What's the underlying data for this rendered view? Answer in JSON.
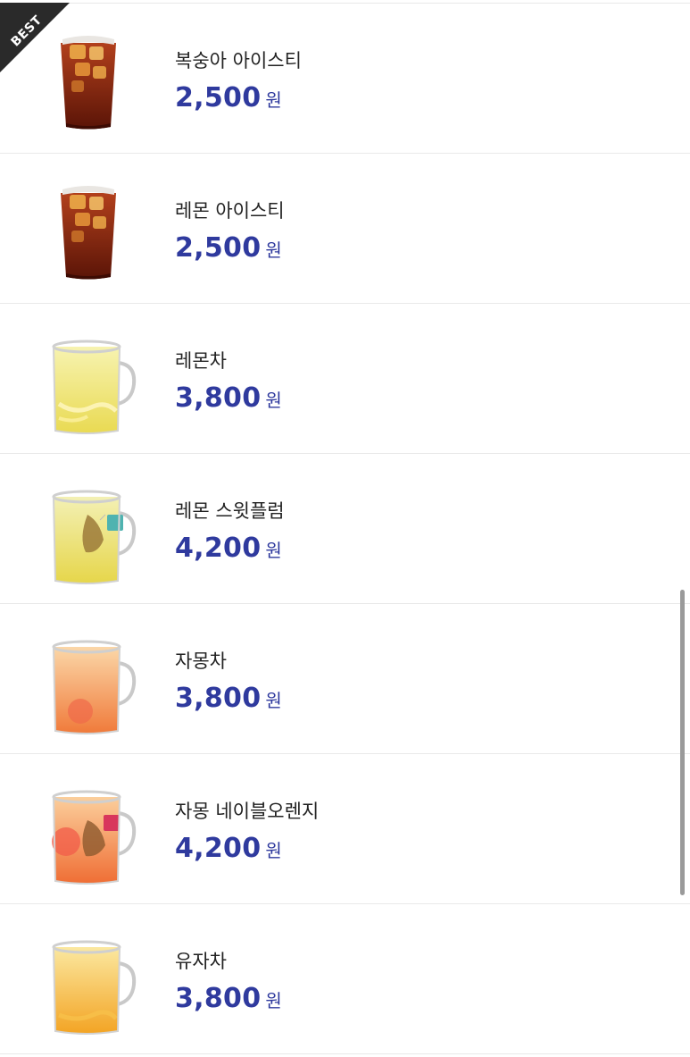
{
  "badge": {
    "label": "BEST"
  },
  "menu": {
    "currency": "원",
    "items": [
      {
        "name": "복숭아 아이스티",
        "price": "2,500",
        "image": "iced-tea-cup-icon"
      },
      {
        "name": "레몬 아이스티",
        "price": "2,500",
        "image": "iced-tea-cup-icon"
      },
      {
        "name": "레몬차",
        "price": "3,800",
        "image": "lemon-tea-mug-icon"
      },
      {
        "name": "레몬 스윗플럼",
        "price": "4,200",
        "image": "lemon-plum-tea-mug-icon"
      },
      {
        "name": "자몽차",
        "price": "3,800",
        "image": "grapefruit-tea-mug-icon"
      },
      {
        "name": "자몽 네이블오렌지",
        "price": "4,200",
        "image": "grapefruit-orange-tea-mug-icon"
      },
      {
        "name": "유자차",
        "price": "3,800",
        "image": "yuja-tea-mug-icon"
      }
    ]
  },
  "colors": {
    "price": "#2f3a9e",
    "divider": "#e9e9e9",
    "badge": "#2a2a2a"
  }
}
